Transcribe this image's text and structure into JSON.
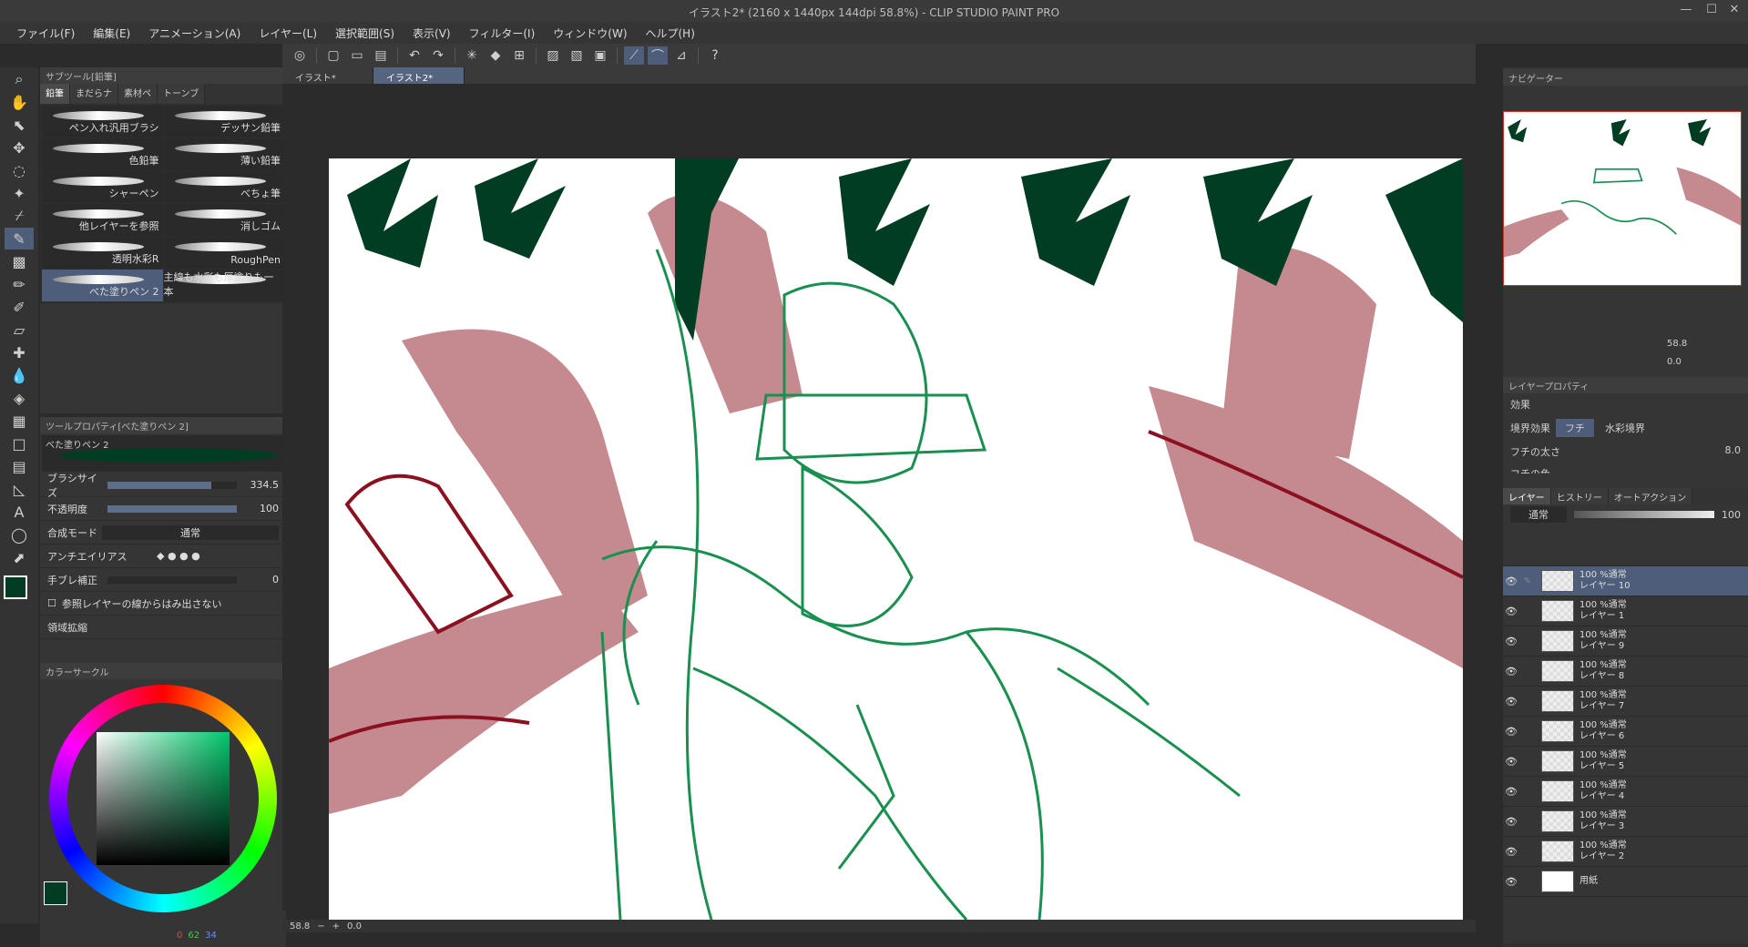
{
  "window": {
    "title": "イラスト2* (2160 x 1440px 144dpi 58.8%) - CLIP STUDIO PAINT PRO"
  },
  "menu": [
    "ファイル(F)",
    "編集(E)",
    "アニメーション(A)",
    "レイヤー(L)",
    "選択範囲(S)",
    "表示(V)",
    "フィルター(I)",
    "ウィンドウ(W)",
    "ヘルプ(H)"
  ],
  "subtool": {
    "header": "サブツール[鉛筆]",
    "tabs": [
      "鉛筆",
      "まだらナ",
      "素材ペ",
      "トーンブ"
    ],
    "brushes": [
      "ペン入れ汎用ブラシ",
      "デッサン鉛筆",
      "色鉛筆",
      "薄い鉛筆",
      "シャーペン",
      "べちょ筆",
      "他レイヤーを参照",
      "消しゴム",
      "透明水彩R",
      "RoughPen",
      "べた塗りペン 2",
      "主線も水彩も厚塗りも一本"
    ]
  },
  "toolprop": {
    "header": "ツールプロパティ[べた塗りペン 2]",
    "brushname": "べた塗りペン 2",
    "brushsize_label": "ブラシサイズ",
    "brushsize": "334.5",
    "opacity_label": "不透明度",
    "opacity": "100",
    "blend_label": "合成モード",
    "blend": "通常",
    "aa_label": "アンチエイリアス",
    "stab_label": "手ブレ補正",
    "stab": "0",
    "ref_label": "参照レイヤーの線からはみ出さない",
    "expand_label": "領域拡縮"
  },
  "colorwheel": {
    "header": "カラーサークル",
    "r": "0",
    "g": "62",
    "b": "34",
    "main_color": "#003d22"
  },
  "doctabs": [
    "イラスト*",
    "イラスト2*"
  ],
  "status": {
    "zoom": "58.8",
    "angle": "0.0"
  },
  "navigator": {
    "header": "ナビゲーター",
    "zoom": "58.8",
    "angle": "0.0"
  },
  "layerprop": {
    "header": "レイヤープロパティ",
    "effect": "効果",
    "border_effect": "境界効果",
    "fuchi": "フチ",
    "watercolor": "水彩境界",
    "edge_thickness": "フチの太さ",
    "edge_val": "8.0",
    "edge_color": "フチの色"
  },
  "layerpanel": {
    "tabs": [
      "レイヤー",
      "ヒストリー",
      "オートアクション"
    ],
    "blend": "通常",
    "opacity": "100",
    "layers": [
      {
        "pct": "100 %通常",
        "name": "レイヤー 10",
        "active": true
      },
      {
        "pct": "100 %通常",
        "name": "レイヤー 1"
      },
      {
        "pct": "100 %通常",
        "name": "レイヤー 9"
      },
      {
        "pct": "100 %通常",
        "name": "レイヤー 8"
      },
      {
        "pct": "100 %通常",
        "name": "レイヤー 7"
      },
      {
        "pct": "100 %通常",
        "name": "レイヤー 6"
      },
      {
        "pct": "100 %通常",
        "name": "レイヤー 5"
      },
      {
        "pct": "100 %通常",
        "name": "レイヤー 4"
      },
      {
        "pct": "100 %通常",
        "name": "レイヤー 3"
      },
      {
        "pct": "100 %通常",
        "name": "レイヤー 2"
      },
      {
        "pct": "",
        "name": "用紙"
      }
    ]
  },
  "icons": {
    "eye": "👁"
  }
}
